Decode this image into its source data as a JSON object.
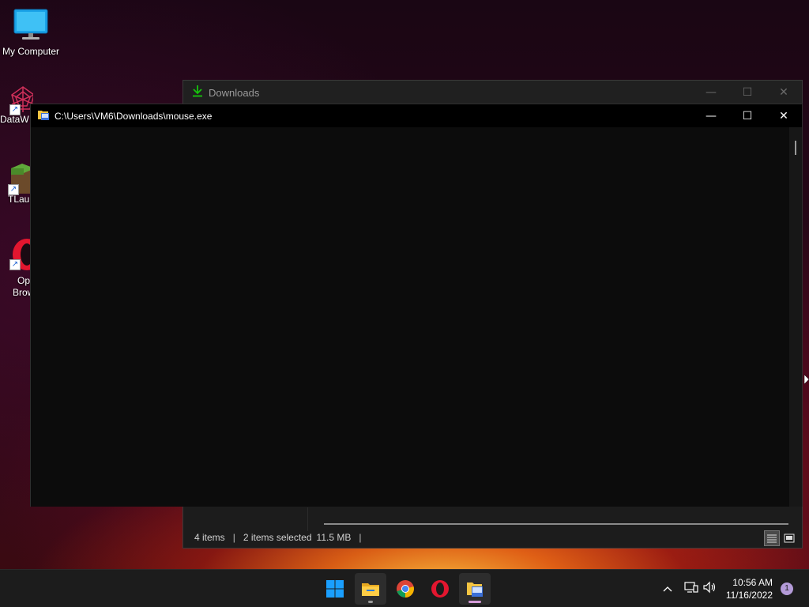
{
  "desktop": {
    "icons": [
      {
        "label": "My Computer",
        "icon": "monitor-icon"
      },
      {
        "label": "DataW",
        "icon": "datawave-icon",
        "shortcut": true
      },
      {
        "label": "TLaun",
        "icon": "tlauncher-icon",
        "shortcut": true
      },
      {
        "label": "Op\nBrow",
        "label_line1": "Op",
        "label_line2": "Brow",
        "icon": "opera-icon",
        "shortcut": true
      }
    ]
  },
  "explorer": {
    "title": "Downloads",
    "title_icon": "download-arrow-icon",
    "status": {
      "item_count": "4 items",
      "selected": "2 items selected",
      "size": "11.5 MB"
    },
    "colors": {
      "download_icon": "#16c60c"
    }
  },
  "console": {
    "title": "C:\\Users\\VM6\\Downloads\\mouse.exe",
    "title_icon": "console-app-icon",
    "background": "#0c0c0c"
  },
  "taskbar": {
    "apps": [
      {
        "name": "Start",
        "icon": "windows-start-icon"
      },
      {
        "name": "File Explorer",
        "icon": "file-explorer-icon",
        "running": true
      },
      {
        "name": "Google Chrome",
        "icon": "chrome-icon"
      },
      {
        "name": "Opera",
        "icon": "opera-icon"
      },
      {
        "name": "mouse.exe",
        "icon": "console-app-icon",
        "running": true,
        "active": true
      }
    ],
    "tray": {
      "time": "10:56 AM",
      "date": "11/16/2022",
      "notification_count": "1"
    }
  }
}
